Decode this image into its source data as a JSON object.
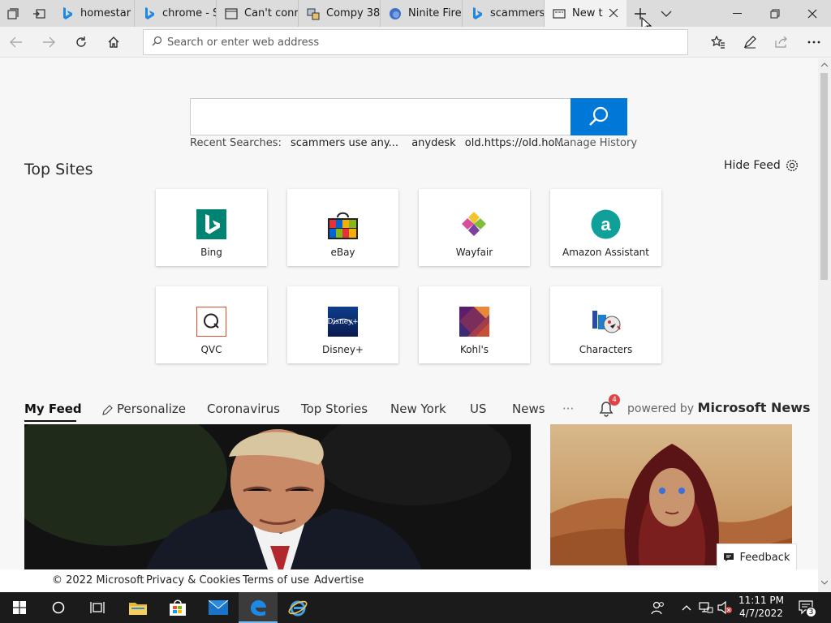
{
  "tabs": [
    {
      "title": "homestar",
      "icon": "bing-icon"
    },
    {
      "title": "chrome - S",
      "icon": "bing-icon"
    },
    {
      "title": "Can't conr",
      "icon": "page-icon"
    },
    {
      "title": "Compy 38",
      "icon": "compy-icon"
    },
    {
      "title": "Ninite Fire",
      "icon": "firefox-icon"
    },
    {
      "title": "scammers",
      "icon": "bing-icon"
    },
    {
      "title": "New t",
      "icon": "newtab-icon",
      "active": true
    }
  ],
  "address": {
    "placeholder": "Search or enter web address"
  },
  "search": {
    "recent_label": "Recent Searches:",
    "recent": [
      "scammers use any...",
      "anydesk",
      "old.https://old.ho..."
    ],
    "manage_history": "Manage History"
  },
  "top_sites": {
    "title": "Top Sites",
    "hide_feed": "Hide Feed",
    "tiles": [
      "Bing",
      "eBay",
      "Wayfair",
      "Amazon Assistant",
      "QVC",
      "Disney+",
      "Kohl's",
      "Characters"
    ]
  },
  "feed": {
    "tabs": [
      "My Feed",
      "Personalize",
      "Coronavirus",
      "Top Stories",
      "New York",
      "US",
      "News"
    ],
    "more": "···",
    "notification_count": "4",
    "powered_prefix": "powered by",
    "powered_brand": "Microsoft News",
    "feedback": "Feedback"
  },
  "footer": {
    "copyright": "© 2022 Microsoft",
    "privacy": "Privacy & Cookies",
    "terms": "Terms of use",
    "advertise": "Advertise"
  },
  "taskbar": {
    "time": "11:11 PM",
    "date": "4/7/2022",
    "notifications": "3"
  },
  "colors": {
    "accent": "#0078d7",
    "bing": "#008373"
  }
}
